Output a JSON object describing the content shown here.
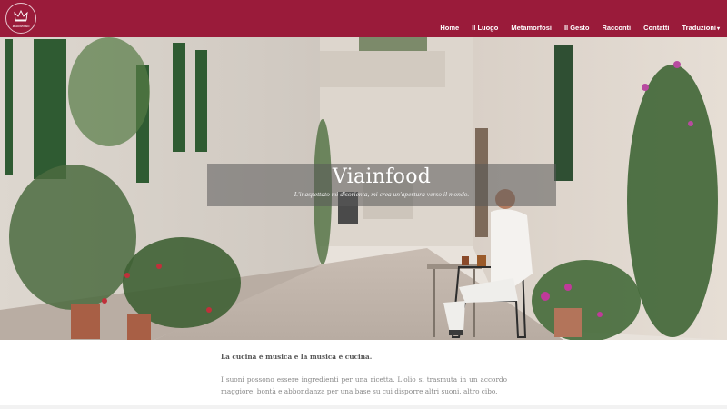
{
  "header": {
    "logo_text": "Buonvino",
    "nav": [
      {
        "label": "Home"
      },
      {
        "label": "Il Luogo"
      },
      {
        "label": "Metamorfosi"
      },
      {
        "label": "Il Gesto"
      },
      {
        "label": "Racconti"
      },
      {
        "label": "Contatti"
      },
      {
        "label": "Traduzioni",
        "caret": "▾"
      }
    ]
  },
  "hero": {
    "title": "Viainfood",
    "subtitle": "L'inaspettato mi disorienta, mi crea un'apertura verso il mondo."
  },
  "content": {
    "lead": "La cucina è musica e la musica è cucina.",
    "paragraph": "I suoni possono essere ingredienti per una ricetta. L'olio si trasmuta in un accordo maggiore, bontà e abbondanza per una base su cui disporre altri suoni, altro cibo."
  },
  "colors": {
    "brand": "#9a1b3a",
    "nav_text": "#ffffff",
    "body_text": "#888888"
  }
}
